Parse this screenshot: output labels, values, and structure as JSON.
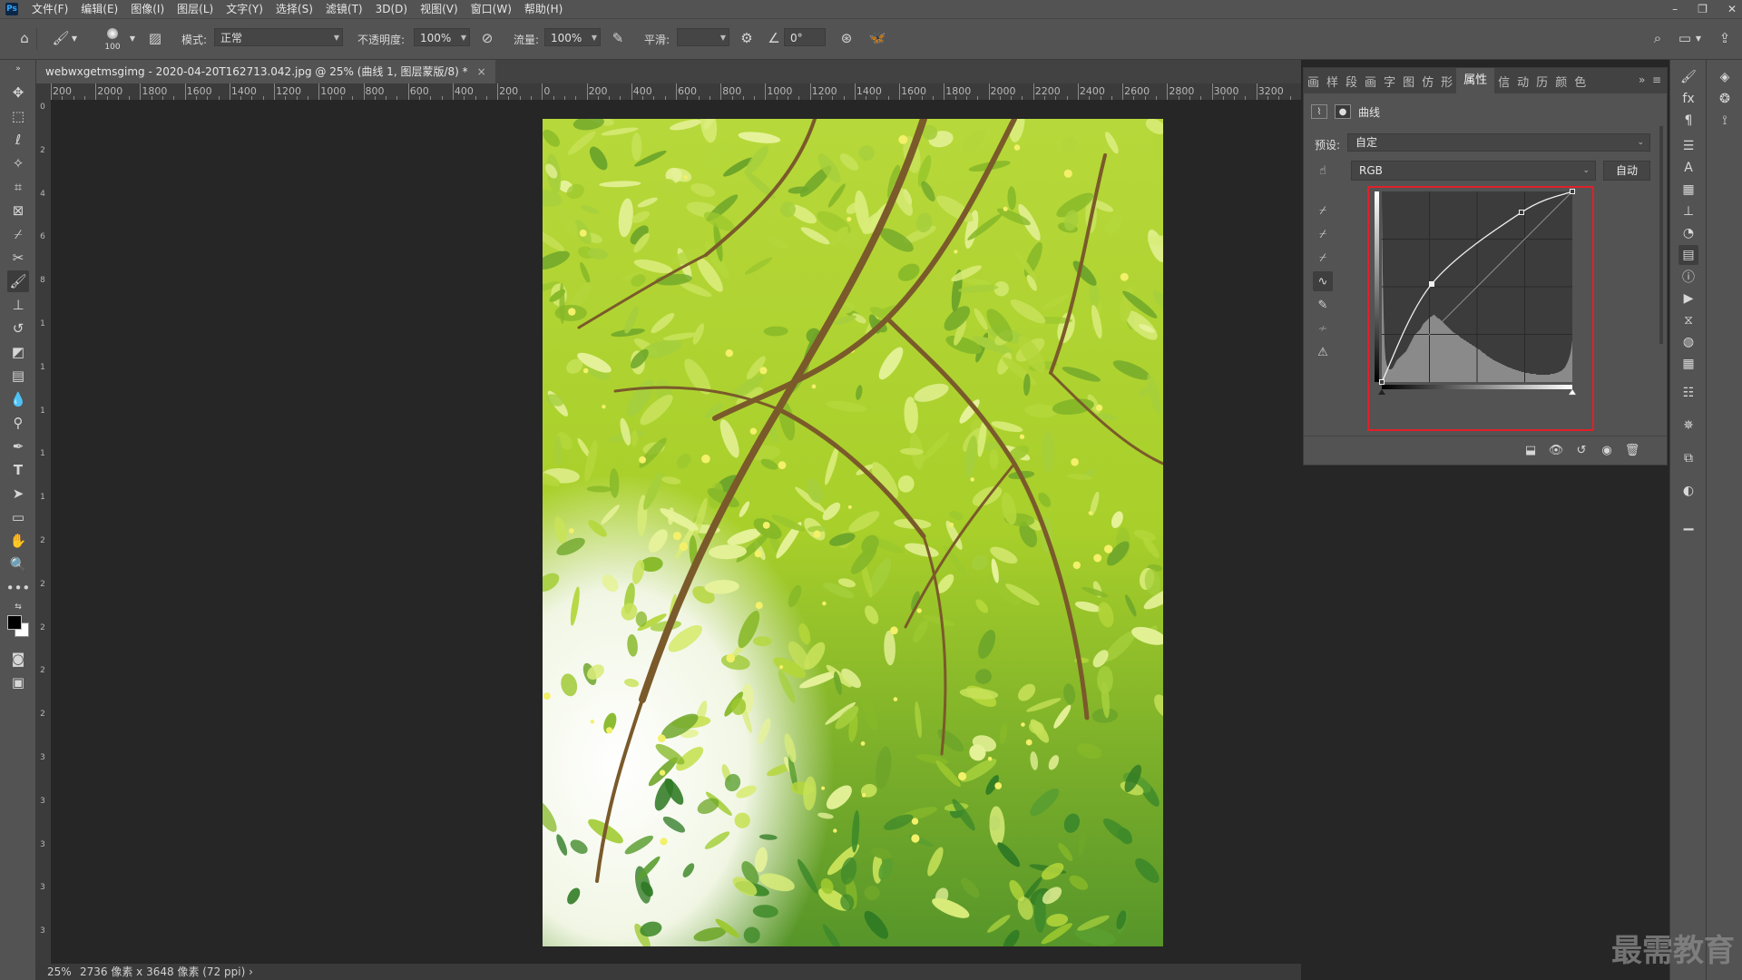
{
  "app": {
    "logo_text": "Ps"
  },
  "menu": [
    "文件(F)",
    "编辑(E)",
    "图像(I)",
    "图层(L)",
    "文字(Y)",
    "选择(S)",
    "滤镜(T)",
    "3D(D)",
    "视图(V)",
    "窗口(W)",
    "帮助(H)"
  ],
  "window_controls": {
    "minimize": "–",
    "restore": "❐",
    "close": "✕"
  },
  "options": {
    "brush_size": "100",
    "mode_label": "模式:",
    "mode_value": "正常",
    "opacity_label": "不透明度:",
    "opacity_value": "100%",
    "flow_label": "流量:",
    "flow_value": "100%",
    "smoothing_label": "平滑:",
    "smoothing_value": "",
    "angle_value": "0°"
  },
  "document": {
    "tab_title": "webwxgetmsgimg - 2020-04-20T162713.042.jpg @ 25% (曲线 1, 图层蒙版/8) *",
    "close_glyph": "×"
  },
  "ruler_top": [
    "200",
    "2000",
    "1800",
    "1600",
    "1400",
    "1200",
    "1000",
    "800",
    "600",
    "400",
    "200",
    "0",
    "200",
    "400",
    "600",
    "800",
    "1000",
    "1200",
    "1400",
    "1600",
    "1800",
    "2000",
    "2200",
    "2400",
    "2600",
    "2800",
    "3000",
    "3200"
  ],
  "ruler_left": [
    "0",
    "2",
    "4",
    "6",
    "8",
    "1",
    "1",
    "1",
    "1",
    "1",
    "2",
    "2",
    "2",
    "2",
    "2",
    "3",
    "3",
    "3",
    "3",
    "3"
  ],
  "status": {
    "zoom": "25%",
    "info": "2736 像素 x 3648 像素 (72 ppi)",
    "arrow": "›"
  },
  "properties": {
    "tabs": [
      "画",
      "样",
      "段",
      "画",
      "字",
      "图",
      "仿",
      "形",
      "属性",
      "信",
      "动",
      "历",
      "颜",
      "色"
    ],
    "active_tab": "属性",
    "panel_title": "曲线",
    "preset_label": "预设:",
    "preset_value": "自定",
    "channel_value": "RGB",
    "auto_button": "自动",
    "expand_glyph": "»",
    "menu_glyph": "≡"
  },
  "curve": {
    "points": [
      [
        0,
        0
      ],
      [
        55,
        108
      ],
      [
        154,
        187
      ],
      [
        210,
        210
      ]
    ],
    "histogram": [
      198,
      120,
      70,
      40,
      26,
      20,
      17,
      15,
      14,
      14,
      14,
      15,
      16,
      18,
      20,
      22,
      24,
      25,
      26,
      27,
      28,
      29,
      30,
      31,
      32,
      33,
      34,
      36,
      38,
      40,
      42,
      44,
      46,
      48,
      50,
      52,
      53,
      54,
      55,
      56,
      57,
      58,
      60,
      62,
      64,
      65,
      66,
      67,
      68,
      69,
      70,
      71,
      72,
      72,
      73,
      74,
      74,
      73,
      72,
      71,
      70,
      70,
      69,
      68,
      67,
      66,
      65,
      64,
      63,
      62,
      61,
      60,
      59,
      58,
      57,
      56,
      55,
      54,
      54,
      53,
      52,
      52,
      51,
      50,
      49,
      48,
      48,
      47,
      46,
      46,
      45,
      44,
      44,
      43,
      42,
      42,
      41,
      40,
      40,
      39,
      38,
      38,
      37,
      36,
      36,
      35,
      34,
      33,
      32,
      32,
      31,
      30,
      29,
      28,
      28,
      27,
      26,
      26,
      25,
      24,
      24,
      23,
      23,
      22,
      22,
      21,
      21,
      20,
      20,
      19,
      19,
      18,
      18,
      17,
      17,
      16,
      16,
      16,
      15,
      15,
      14,
      14,
      14,
      13,
      13,
      13,
      12,
      12,
      12,
      11,
      11,
      11,
      11,
      10,
      10,
      10,
      10,
      10,
      9,
      9,
      9,
      9,
      9,
      9,
      9,
      8,
      8,
      8,
      8,
      8,
      8,
      8,
      8,
      8,
      8,
      8,
      8,
      8,
      8,
      8,
      9,
      9,
      9,
      9,
      9,
      10,
      10,
      10,
      11,
      11,
      12,
      12,
      13,
      14,
      15,
      16,
      18,
      20,
      22,
      25,
      28,
      32,
      38,
      46
    ]
  },
  "watermark": "最需教育"
}
